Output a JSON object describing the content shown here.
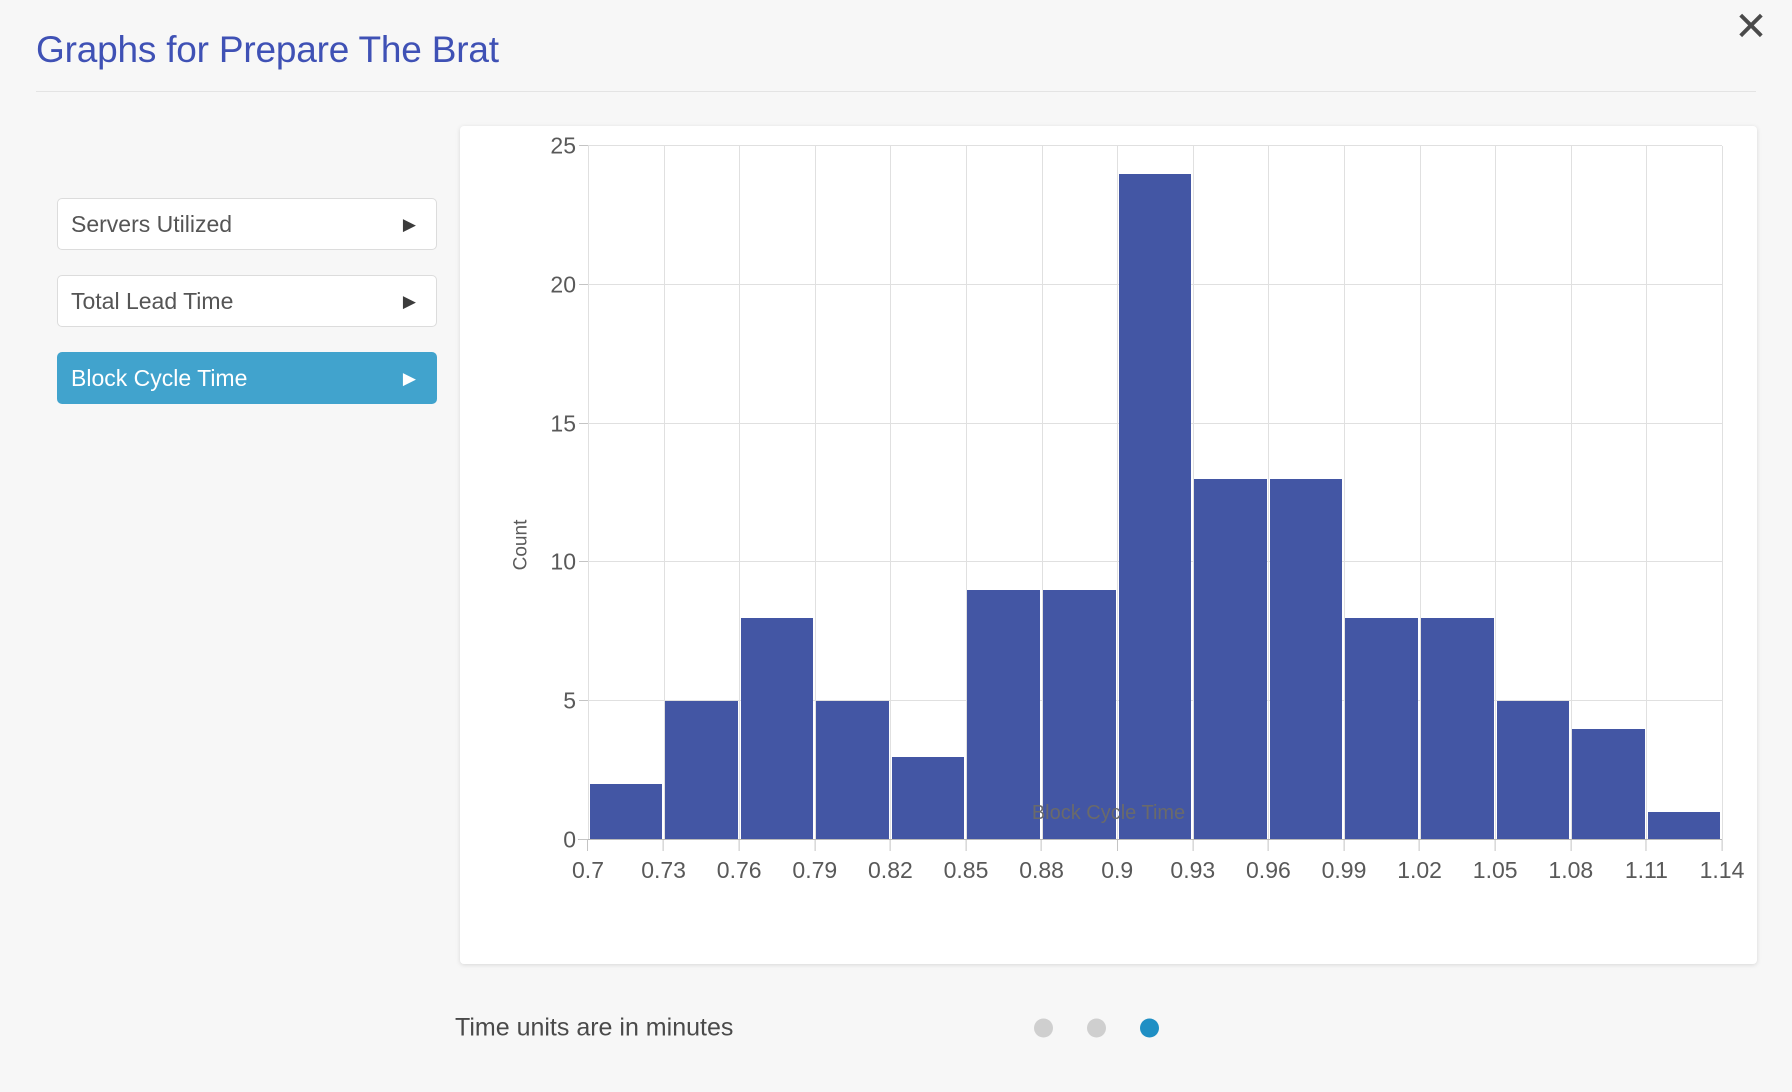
{
  "header": {
    "title": "Graphs for Prepare The Brat",
    "close_label": "✕",
    "title_color": "#3f51b5"
  },
  "sidebar": {
    "items": [
      {
        "label": "Servers Utilized",
        "arrow": "▶",
        "active": false
      },
      {
        "label": "Total Lead Time",
        "arrow": "▶",
        "active": false
      },
      {
        "label": "Block Cycle Time",
        "arrow": "▶",
        "active": true
      }
    ],
    "active_color": "#41a3cd"
  },
  "footer": {
    "note": "Time units are in minutes",
    "dots": [
      {
        "active": false
      },
      {
        "active": false
      },
      {
        "active": true
      }
    ],
    "active_dot_color": "#1f8fc4",
    "inactive_dot_color": "#cfcfcf"
  },
  "chart_data": {
    "type": "bar",
    "title": "",
    "xlabel": "Block Cycle Time",
    "ylabel": "Count",
    "bar_color": "#4356a4",
    "grid": true,
    "legend": "none",
    "ylim": [
      0,
      25
    ],
    "yticks": [
      0,
      5,
      10,
      15,
      20,
      25
    ],
    "xlim": [
      0.7,
      1.14
    ],
    "xticks": [
      "0.7",
      "0.73",
      "0.76",
      "0.79",
      "0.82",
      "0.85",
      "0.88",
      "0.9",
      "0.93",
      "0.96",
      "0.99",
      "1.02",
      "1.05",
      "1.08",
      "1.11",
      "1.14"
    ],
    "bin_edges": [
      0.7,
      0.73,
      0.76,
      0.79,
      0.82,
      0.85,
      0.88,
      0.9,
      0.93,
      0.96,
      0.99,
      1.02,
      1.05,
      1.08,
      1.11,
      1.14
    ],
    "categories": [
      "0.70-0.73",
      "0.73-0.76",
      "0.76-0.79",
      "0.79-0.82",
      "0.82-0.85",
      "0.85-0.88",
      "0.88-0.90",
      "0.90-0.93",
      "0.93-0.96",
      "0.96-0.99",
      "0.99-1.02",
      "1.02-1.05",
      "1.05-1.08",
      "1.08-1.11",
      "1.11-1.14"
    ],
    "values": [
      2,
      5,
      8,
      5,
      3,
      9,
      9,
      24,
      13,
      13,
      8,
      8,
      5,
      4,
      1
    ]
  }
}
